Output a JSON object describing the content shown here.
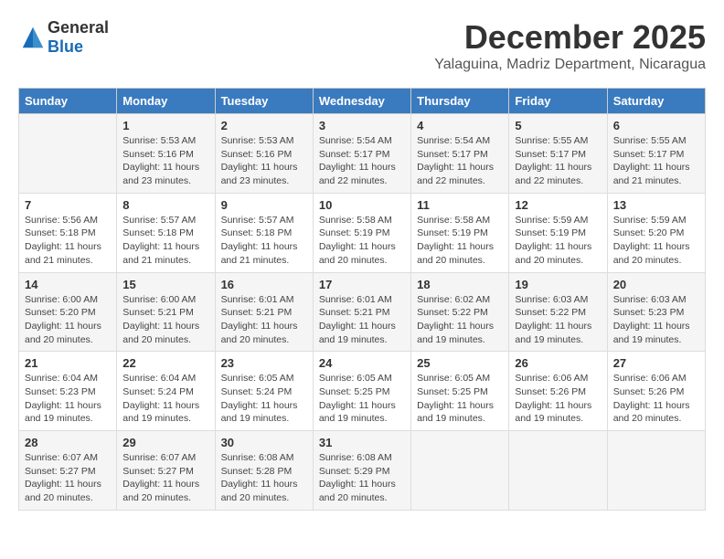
{
  "logo": {
    "general": "General",
    "blue": "Blue"
  },
  "title": "December 2025",
  "subtitle": "Yalaguina, Madriz Department, Nicaragua",
  "headers": [
    "Sunday",
    "Monday",
    "Tuesday",
    "Wednesday",
    "Thursday",
    "Friday",
    "Saturday"
  ],
  "weeks": [
    [
      {
        "day": "",
        "info": ""
      },
      {
        "day": "1",
        "info": "Sunrise: 5:53 AM\nSunset: 5:16 PM\nDaylight: 11 hours\nand 23 minutes."
      },
      {
        "day": "2",
        "info": "Sunrise: 5:53 AM\nSunset: 5:16 PM\nDaylight: 11 hours\nand 23 minutes."
      },
      {
        "day": "3",
        "info": "Sunrise: 5:54 AM\nSunset: 5:17 PM\nDaylight: 11 hours\nand 22 minutes."
      },
      {
        "day": "4",
        "info": "Sunrise: 5:54 AM\nSunset: 5:17 PM\nDaylight: 11 hours\nand 22 minutes."
      },
      {
        "day": "5",
        "info": "Sunrise: 5:55 AM\nSunset: 5:17 PM\nDaylight: 11 hours\nand 22 minutes."
      },
      {
        "day": "6",
        "info": "Sunrise: 5:55 AM\nSunset: 5:17 PM\nDaylight: 11 hours\nand 21 minutes."
      }
    ],
    [
      {
        "day": "7",
        "info": "Sunrise: 5:56 AM\nSunset: 5:18 PM\nDaylight: 11 hours\nand 21 minutes."
      },
      {
        "day": "8",
        "info": "Sunrise: 5:57 AM\nSunset: 5:18 PM\nDaylight: 11 hours\nand 21 minutes."
      },
      {
        "day": "9",
        "info": "Sunrise: 5:57 AM\nSunset: 5:18 PM\nDaylight: 11 hours\nand 21 minutes."
      },
      {
        "day": "10",
        "info": "Sunrise: 5:58 AM\nSunset: 5:19 PM\nDaylight: 11 hours\nand 20 minutes."
      },
      {
        "day": "11",
        "info": "Sunrise: 5:58 AM\nSunset: 5:19 PM\nDaylight: 11 hours\nand 20 minutes."
      },
      {
        "day": "12",
        "info": "Sunrise: 5:59 AM\nSunset: 5:19 PM\nDaylight: 11 hours\nand 20 minutes."
      },
      {
        "day": "13",
        "info": "Sunrise: 5:59 AM\nSunset: 5:20 PM\nDaylight: 11 hours\nand 20 minutes."
      }
    ],
    [
      {
        "day": "14",
        "info": "Sunrise: 6:00 AM\nSunset: 5:20 PM\nDaylight: 11 hours\nand 20 minutes."
      },
      {
        "day": "15",
        "info": "Sunrise: 6:00 AM\nSunset: 5:21 PM\nDaylight: 11 hours\nand 20 minutes."
      },
      {
        "day": "16",
        "info": "Sunrise: 6:01 AM\nSunset: 5:21 PM\nDaylight: 11 hours\nand 20 minutes."
      },
      {
        "day": "17",
        "info": "Sunrise: 6:01 AM\nSunset: 5:21 PM\nDaylight: 11 hours\nand 19 minutes."
      },
      {
        "day": "18",
        "info": "Sunrise: 6:02 AM\nSunset: 5:22 PM\nDaylight: 11 hours\nand 19 minutes."
      },
      {
        "day": "19",
        "info": "Sunrise: 6:03 AM\nSunset: 5:22 PM\nDaylight: 11 hours\nand 19 minutes."
      },
      {
        "day": "20",
        "info": "Sunrise: 6:03 AM\nSunset: 5:23 PM\nDaylight: 11 hours\nand 19 minutes."
      }
    ],
    [
      {
        "day": "21",
        "info": "Sunrise: 6:04 AM\nSunset: 5:23 PM\nDaylight: 11 hours\nand 19 minutes."
      },
      {
        "day": "22",
        "info": "Sunrise: 6:04 AM\nSunset: 5:24 PM\nDaylight: 11 hours\nand 19 minutes."
      },
      {
        "day": "23",
        "info": "Sunrise: 6:05 AM\nSunset: 5:24 PM\nDaylight: 11 hours\nand 19 minutes."
      },
      {
        "day": "24",
        "info": "Sunrise: 6:05 AM\nSunset: 5:25 PM\nDaylight: 11 hours\nand 19 minutes."
      },
      {
        "day": "25",
        "info": "Sunrise: 6:05 AM\nSunset: 5:25 PM\nDaylight: 11 hours\nand 19 minutes."
      },
      {
        "day": "26",
        "info": "Sunrise: 6:06 AM\nSunset: 5:26 PM\nDaylight: 11 hours\nand 19 minutes."
      },
      {
        "day": "27",
        "info": "Sunrise: 6:06 AM\nSunset: 5:26 PM\nDaylight: 11 hours\nand 20 minutes."
      }
    ],
    [
      {
        "day": "28",
        "info": "Sunrise: 6:07 AM\nSunset: 5:27 PM\nDaylight: 11 hours\nand 20 minutes."
      },
      {
        "day": "29",
        "info": "Sunrise: 6:07 AM\nSunset: 5:27 PM\nDaylight: 11 hours\nand 20 minutes."
      },
      {
        "day": "30",
        "info": "Sunrise: 6:08 AM\nSunset: 5:28 PM\nDaylight: 11 hours\nand 20 minutes."
      },
      {
        "day": "31",
        "info": "Sunrise: 6:08 AM\nSunset: 5:29 PM\nDaylight: 11 hours\nand 20 minutes."
      },
      {
        "day": "",
        "info": ""
      },
      {
        "day": "",
        "info": ""
      },
      {
        "day": "",
        "info": ""
      }
    ]
  ]
}
